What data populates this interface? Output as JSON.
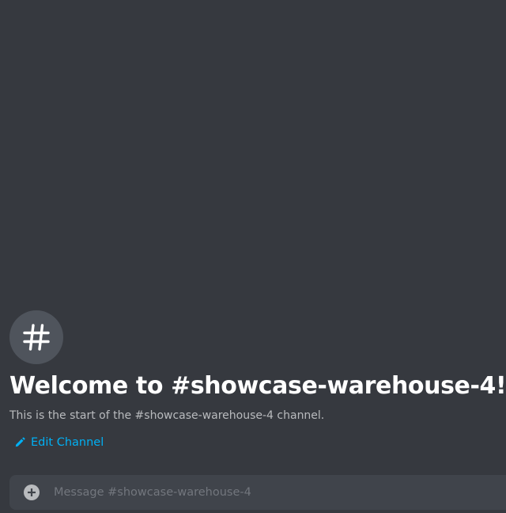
{
  "channel": {
    "name": "showcase-warehouse-4",
    "avatar_icon": "hashtag-icon"
  },
  "welcome": {
    "title": "Welcome to #showcase-warehouse-4!",
    "subtitle": "This is the start of the #showcase-warehouse-4 channel."
  },
  "actions": {
    "edit_channel_label": "Edit Channel",
    "edit_icon": "pencil-icon"
  },
  "composer": {
    "attach_icon": "plus-circle-icon",
    "placeholder": "Message #showcase-warehouse-4",
    "value": ""
  },
  "colors": {
    "background": "#36393f",
    "avatar_bg": "#4f545c",
    "title": "#ffffff",
    "subtitle": "#b9bbbe",
    "link": "#00b0f4",
    "composer_bg": "#40444b",
    "placeholder": "#72767d"
  }
}
